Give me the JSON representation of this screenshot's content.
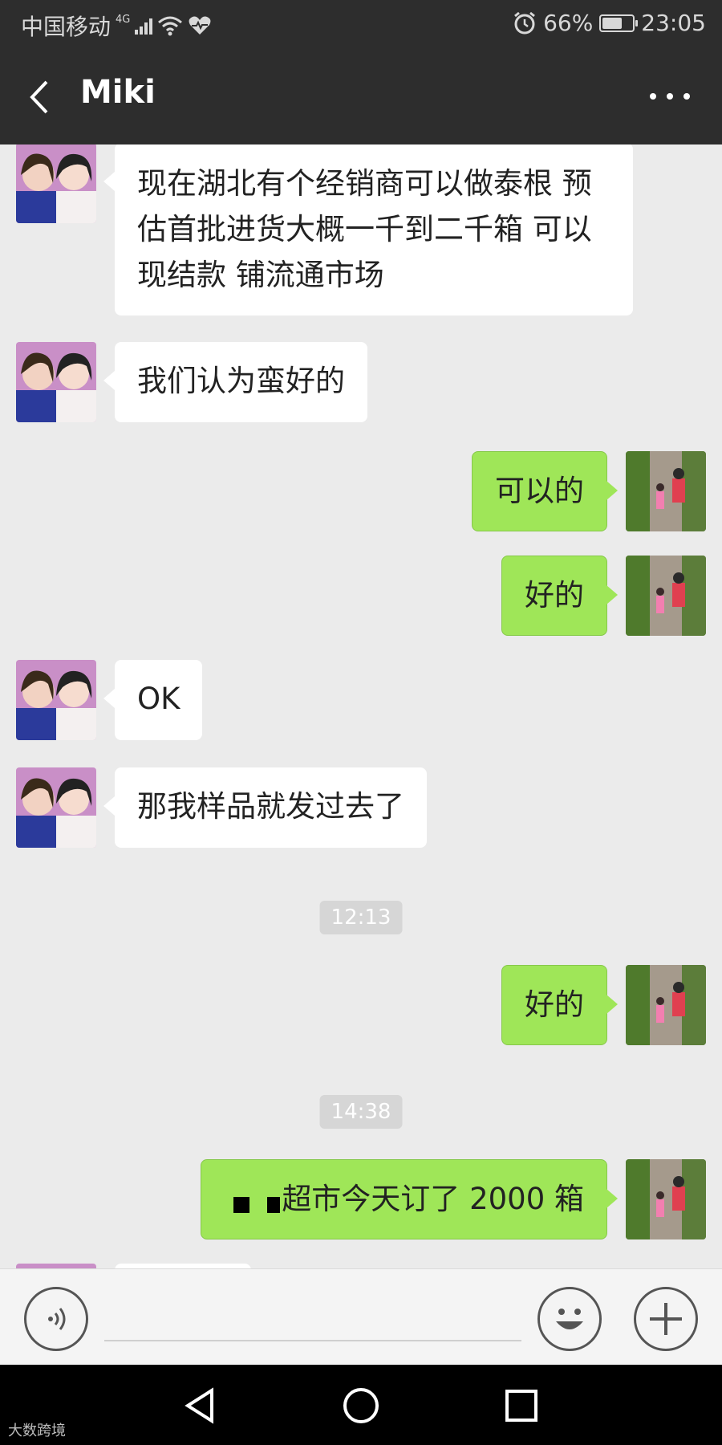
{
  "status_bar": {
    "carrier": "中国移动",
    "network": "4G",
    "battery": "66%",
    "battery_level": 0.66,
    "time": "23:05"
  },
  "header": {
    "title": "Miki"
  },
  "messages": [
    {
      "side": "in",
      "text": "现在湖北有个经销商可以做泰根 预估首批进货大概一千到二千箱 可以现结款 铺流通市场"
    },
    {
      "side": "in",
      "text": "我们认为蛮好的"
    },
    {
      "side": "out",
      "text": "可以的"
    },
    {
      "side": "out",
      "text": "好的"
    },
    {
      "side": "in",
      "text": "OK"
    },
    {
      "side": "in",
      "text": "那我样品就发过去了"
    },
    {
      "type": "time",
      "text": "12:13"
    },
    {
      "side": "out",
      "text": "好的"
    },
    {
      "type": "time",
      "text": "14:38"
    },
    {
      "side": "out",
      "text": "超市今天订了 2000 箱"
    }
  ],
  "watermark": "大数跨境"
}
